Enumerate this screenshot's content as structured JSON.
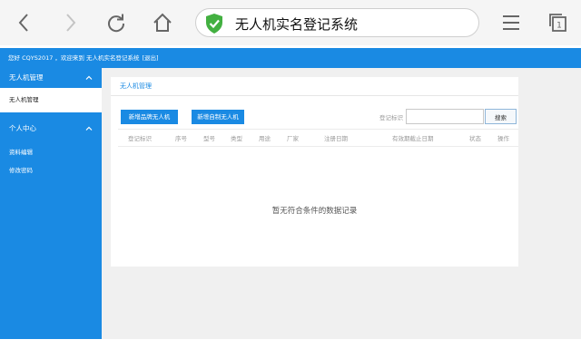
{
  "browser": {
    "url_title": "无人机实名登记系统",
    "icons": [
      "back-icon",
      "forward-icon",
      "reload-icon",
      "home-icon",
      "shield-check-icon",
      "menu-icon",
      "tabs-icon"
    ],
    "tab_count": "1"
  },
  "topbar": {
    "greeting": "您好 CQYS2017 ，欢迎来到 无人机实名登记系统",
    "logout": "[退出]"
  },
  "sidebar": {
    "group1": {
      "title": "无人机管理",
      "items": [
        "无人机管理"
      ]
    },
    "group2": {
      "title": "个人中心",
      "items": [
        "资料编辑",
        "修改密码"
      ]
    }
  },
  "panel": {
    "title": "无人机管理",
    "add_brand_button": "新增品牌无人机",
    "add_custom_button": "新增自制无人机",
    "search_label": "登记标识",
    "search_value": "",
    "search_button": "搜索",
    "columns": [
      "登记标识",
      "序号",
      "型号",
      "类型",
      "用途",
      "厂家",
      "注册日期",
      "有效期截止日期",
      "状态",
      "操作"
    ],
    "empty_text": "暂无符合条件的数据记录"
  },
  "colors": {
    "accent": "#1a8ae3",
    "chrome": "#f5f5f5",
    "content_bg": "#f0f0f0"
  }
}
